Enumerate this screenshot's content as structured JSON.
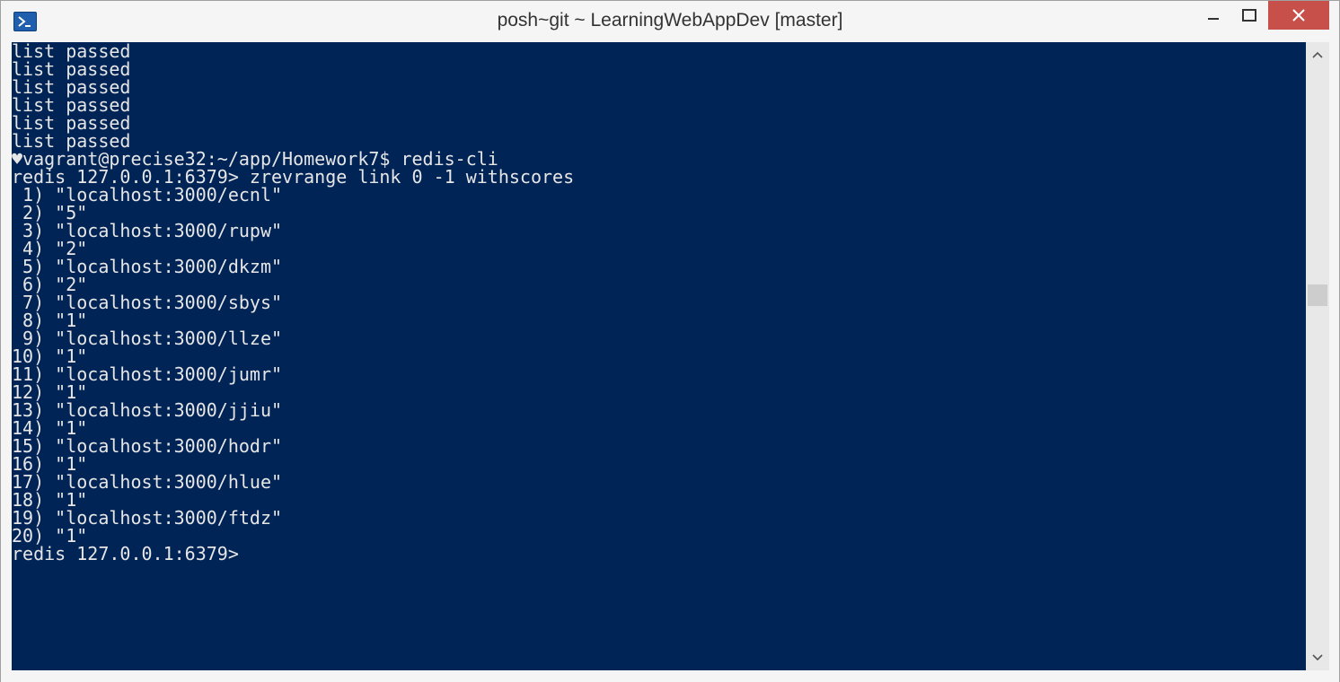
{
  "window": {
    "title": "posh~git ~ LearningWebAppDev [master]",
    "icon": "powershell-icon",
    "colors": {
      "console_bg": "#012456",
      "console_fg": "#e6e6e6",
      "close_bg": "#c7504b"
    }
  },
  "console": {
    "lines": [
      "list passed",
      "list passed",
      "list passed",
      "list passed",
      "list passed",
      "list passed",
      "♥vagrant@precise32:~/app/Homework7$ redis-cli",
      "redis 127.0.0.1:6379> zrevrange link 0 -1 withscores",
      " 1) \"localhost:3000/ecnl\"",
      " 2) \"5\"",
      " 3) \"localhost:3000/rupw\"",
      " 4) \"2\"",
      " 5) \"localhost:3000/dkzm\"",
      " 6) \"2\"",
      " 7) \"localhost:3000/sbys\"",
      " 8) \"1\"",
      " 9) \"localhost:3000/llze\"",
      "10) \"1\"",
      "11) \"localhost:3000/jumr\"",
      "12) \"1\"",
      "13) \"localhost:3000/jjiu\"",
      "14) \"1\"",
      "15) \"localhost:3000/hodr\"",
      "16) \"1\"",
      "17) \"localhost:3000/hlue\"",
      "18) \"1\"",
      "19) \"localhost:3000/ftdz\"",
      "20) \"1\"",
      "redis 127.0.0.1:6379>"
    ]
  }
}
